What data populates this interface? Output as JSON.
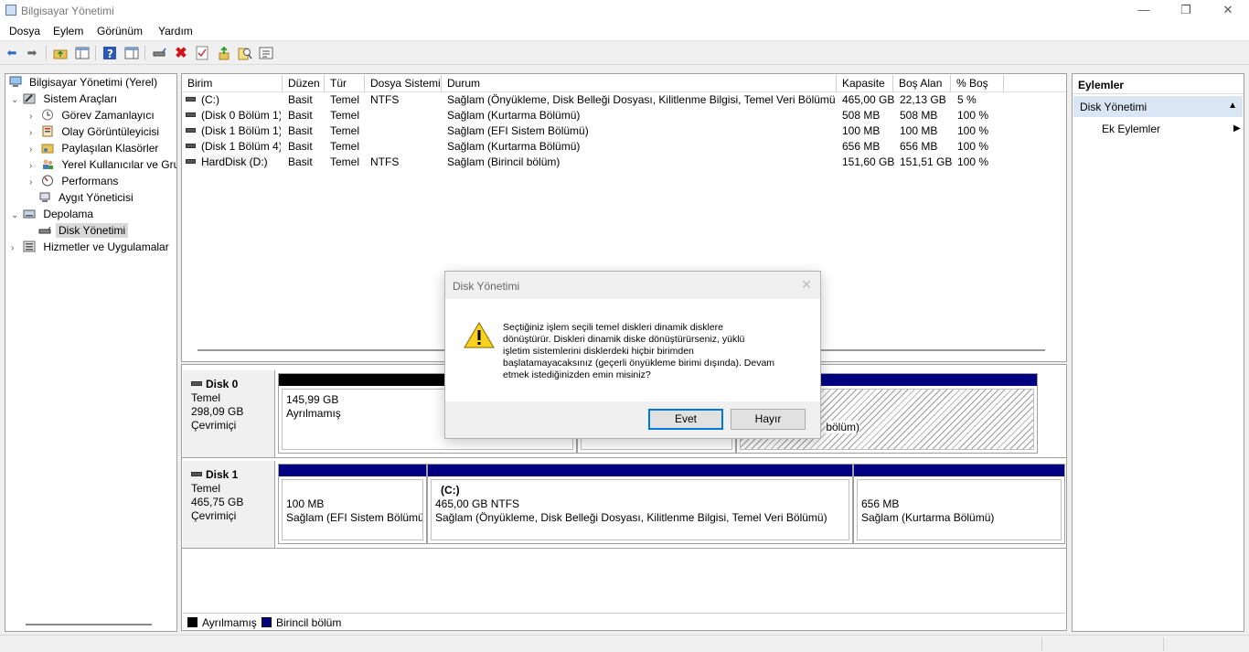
{
  "window": {
    "title": "Bilgisayar Yönetimi"
  },
  "menu": [
    "Dosya",
    "Eylem",
    "Görünüm",
    "Yardım"
  ],
  "toolbar": {
    "icons": [
      "back-icon",
      "forward-icon",
      "up-folder-icon",
      "show-hide-tree-icon",
      "help-icon",
      "properties-icon",
      "connect-icon",
      "delete-icon",
      "checkmark-icon",
      "move-up-icon",
      "search-icon",
      "details-icon"
    ]
  },
  "tree": {
    "root": "Bilgisayar Yönetimi (Yerel)",
    "system_tools": "Sistem Araçları",
    "task_scheduler": "Görev Zamanlayıcı",
    "event_viewer": "Olay Görüntüleyicisi",
    "shared_folders": "Paylaşılan Klasörler",
    "local_users": "Yerel Kullanıcılar ve Gru",
    "performance": "Performans",
    "device_manager": "Aygıt Yöneticisi",
    "storage": "Depolama",
    "disk_management": "Disk Yönetimi",
    "services": "Hizmetler ve Uygulamalar"
  },
  "volume_table": {
    "headers": [
      "Birim",
      "Düzen",
      "Tür",
      "Dosya Sistemi",
      "Durum",
      "Kapasite",
      "Boş Alan",
      "% Boş"
    ],
    "rows": [
      [
        "(C:)",
        "Basit",
        "Temel",
        "NTFS",
        "Sağlam (Önyükleme, Disk Belleği Dosyası, Kilitlenme Bilgisi, Temel Veri Bölümü)",
        "465,00 GB",
        "22,13 GB",
        "5 %"
      ],
      [
        "(Disk 0 Bölüm 1)",
        "Basit",
        "Temel",
        "",
        "Sağlam (Kurtarma Bölümü)",
        "508 MB",
        "508 MB",
        "100 %"
      ],
      [
        "(Disk 1 Bölüm 1)",
        "Basit",
        "Temel",
        "",
        "Sağlam (EFI Sistem Bölümü)",
        "100 MB",
        "100 MB",
        "100 %"
      ],
      [
        "(Disk 1 Bölüm 4)",
        "Basit",
        "Temel",
        "",
        "Sağlam (Kurtarma Bölümü)",
        "656 MB",
        "656 MB",
        "100 %"
      ],
      [
        "HardDisk (D:)",
        "Basit",
        "Temel",
        "NTFS",
        "Sağlam (Birincil bölüm)",
        "151,60 GB",
        "151,51 GB",
        "100 %"
      ]
    ]
  },
  "disks": {
    "disk0": {
      "name": "Disk 0",
      "type": "Temel",
      "size": "298,09 GB",
      "status": "Çevrimiçi",
      "p1_size": "145,99 GB",
      "p1_label": "Ayrılmamış",
      "p3_label": "bölüm)"
    },
    "disk1": {
      "name": "Disk 1",
      "type": "Temel",
      "size": "465,75 GB",
      "status": "Çevrimiçi",
      "p1_size": "100 MB",
      "p1_label": "Sağlam (EFI Sistem Bölümü)",
      "p2_name": "(C:)",
      "p2_size": "465,00 GB NTFS",
      "p2_label": "Sağlam (Önyükleme, Disk Belleği Dosyası, Kilitlenme Bilgisi, Temel Veri Bölümü)",
      "p3_size": "656 MB",
      "p3_label": "Sağlam (Kurtarma Bölümü)"
    }
  },
  "legend": {
    "unallocated": "Ayrılmamış",
    "primary": "Birincil bölüm"
  },
  "actions": {
    "header": "Eylemler",
    "section": "Disk Yönetimi",
    "more": "Ek Eylemler"
  },
  "dialog": {
    "title": "Disk Yönetimi",
    "line1": "Seçtiğiniz işlem seçili temel diskleri dinamik disklere",
    "line2": "dönüştürür. Diskleri dinamik diske dönüştürürseniz, yüklü",
    "line3": "işletim sistemlerini disklerdeki hiçbir birimden",
    "line4": "başlatamayacaksınız (geçerli önyükleme birimi dışında). Devam",
    "line5": "etmek istediğinizden emin misiniz?",
    "yes": "Evet",
    "no": "Hayır"
  },
  "colors": {
    "primary_partition": "#000080",
    "unallocated": "#000000",
    "selection": "#dbe6f4"
  }
}
